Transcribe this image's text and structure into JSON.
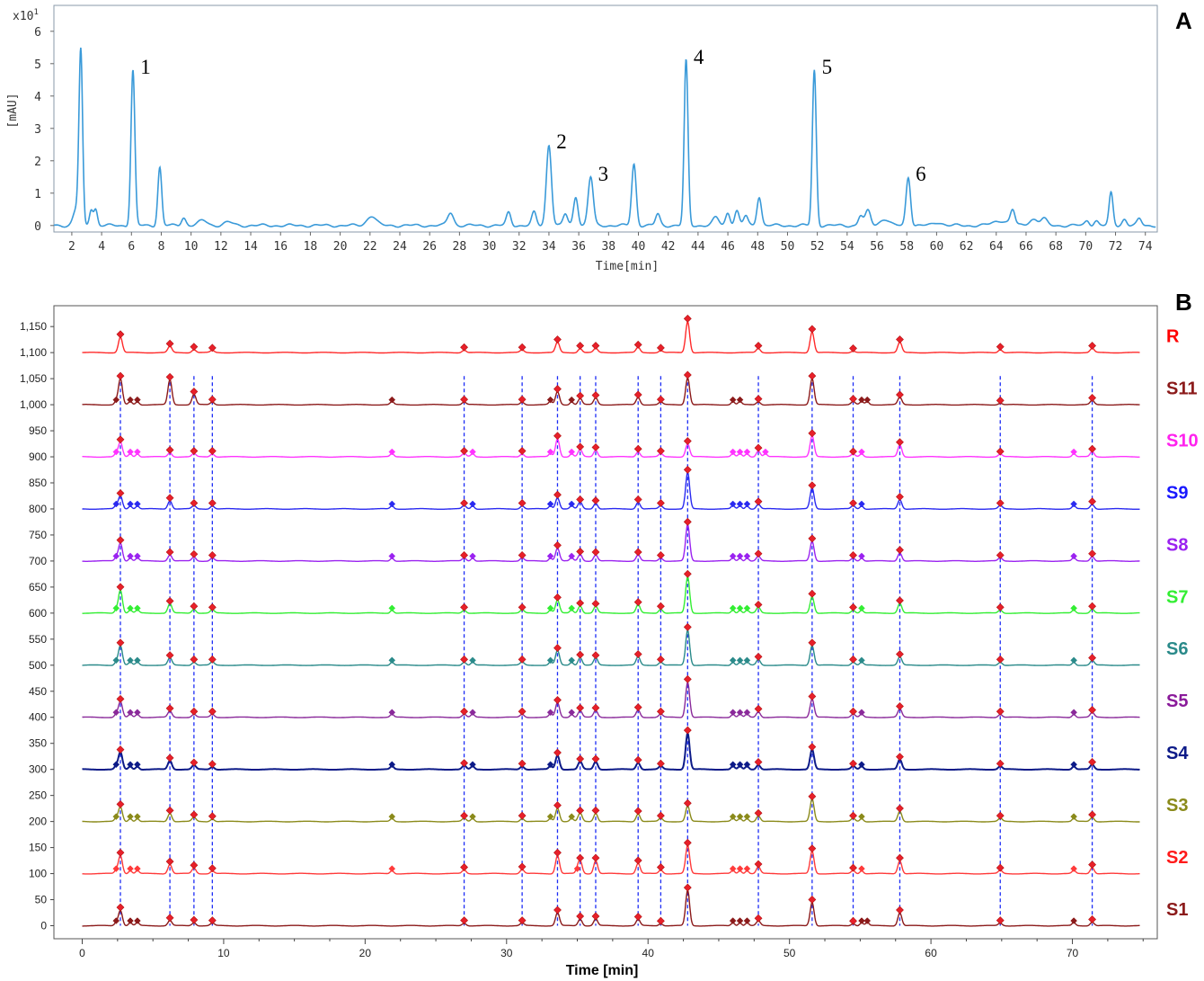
{
  "panel_a": {
    "letter": "A",
    "multiplier": "x10",
    "multiplier_exp": "1",
    "ylabel": "[mAU]",
    "xlabel": "Time[min]"
  },
  "panel_b": {
    "letter": "B",
    "xlabel": "Time [min]"
  },
  "chart_data": [
    {
      "type": "line",
      "panel": "A",
      "xlabel": "Time[min]",
      "ylabel": "[mAU]",
      "y_multiplier": "x10^1",
      "xlim": [
        0.8,
        74.8
      ],
      "ylim": [
        -0.2,
        6.8
      ],
      "x_ticks": [
        2,
        4,
        6,
        8,
        10,
        12,
        14,
        16,
        18,
        20,
        22,
        24,
        26,
        28,
        30,
        32,
        34,
        36,
        38,
        40,
        42,
        44,
        46,
        48,
        50,
        52,
        54,
        56,
        58,
        60,
        62,
        64,
        66,
        68,
        70,
        72,
        74
      ],
      "y_ticks": [
        0,
        1,
        2,
        3,
        4,
        5,
        6
      ],
      "series": [
        {
          "color": "#3a9ad9",
          "peaks": [
            {
              "t": 2.3,
              "h": 0.5,
              "w": 0.2
            },
            {
              "t": 2.6,
              "h": 5.3,
              "w": 0.12
            },
            {
              "t": 3.3,
              "h": 0.5,
              "w": 0.12
            },
            {
              "t": 3.6,
              "h": 0.5,
              "w": 0.12
            },
            {
              "t": 6.1,
              "h": 4.8,
              "w": 0.13
            },
            {
              "t": 7.9,
              "h": 1.8,
              "w": 0.13
            },
            {
              "t": 9.5,
              "h": 0.25,
              "w": 0.15
            },
            {
              "t": 10.8,
              "h": 0.15,
              "w": 0.3
            },
            {
              "t": 12.5,
              "h": 0.1,
              "w": 0.3
            },
            {
              "t": 22.1,
              "h": 0.3,
              "w": 0.3
            },
            {
              "t": 27.4,
              "h": 0.4,
              "w": 0.2
            },
            {
              "t": 31.3,
              "h": 0.4,
              "w": 0.15
            },
            {
              "t": 33.0,
              "h": 0.4,
              "w": 0.15
            },
            {
              "t": 34.0,
              "h": 2.5,
              "w": 0.17
            },
            {
              "t": 35.1,
              "h": 0.35,
              "w": 0.15
            },
            {
              "t": 35.8,
              "h": 0.9,
              "w": 0.15
            },
            {
              "t": 36.8,
              "h": 1.5,
              "w": 0.17
            },
            {
              "t": 39.7,
              "h": 1.9,
              "w": 0.15
            },
            {
              "t": 41.3,
              "h": 0.35,
              "w": 0.15
            },
            {
              "t": 43.2,
              "h": 5.1,
              "w": 0.13
            },
            {
              "t": 45.2,
              "h": 0.25,
              "w": 0.2
            },
            {
              "t": 46.0,
              "h": 0.4,
              "w": 0.15
            },
            {
              "t": 46.6,
              "h": 0.45,
              "w": 0.15
            },
            {
              "t": 47.2,
              "h": 0.3,
              "w": 0.15
            },
            {
              "t": 48.1,
              "h": 0.9,
              "w": 0.15
            },
            {
              "t": 51.8,
              "h": 4.8,
              "w": 0.13
            },
            {
              "t": 54.9,
              "h": 0.3,
              "w": 0.15
            },
            {
              "t": 55.4,
              "h": 0.45,
              "w": 0.18
            },
            {
              "t": 56.5,
              "h": 0.2,
              "w": 0.3
            },
            {
              "t": 58.1,
              "h": 1.5,
              "w": 0.15
            },
            {
              "t": 60.1,
              "h": 0.1,
              "w": 0.3
            },
            {
              "t": 64.3,
              "h": 0.15,
              "w": 0.5
            },
            {
              "t": 65.1,
              "h": 0.45,
              "w": 0.15
            },
            {
              "t": 66.5,
              "h": 0.2,
              "w": 0.3
            },
            {
              "t": 67.2,
              "h": 0.2,
              "w": 0.2
            },
            {
              "t": 70.1,
              "h": 0.15,
              "w": 0.15
            },
            {
              "t": 70.7,
              "h": 0.15,
              "w": 0.15
            },
            {
              "t": 71.7,
              "h": 1.0,
              "w": 0.13
            },
            {
              "t": 72.6,
              "h": 0.2,
              "w": 0.15
            },
            {
              "t": 73.6,
              "h": 0.2,
              "w": 0.15
            }
          ]
        }
      ],
      "annotations": [
        {
          "text": "1",
          "t": 6.1,
          "y": 4.8
        },
        {
          "text": "2",
          "t": 34.0,
          "y": 2.5
        },
        {
          "text": "3",
          "t": 36.8,
          "y": 1.5
        },
        {
          "text": "4",
          "t": 43.2,
          "y": 5.1
        },
        {
          "text": "5",
          "t": 51.8,
          "y": 4.8
        },
        {
          "text": "6",
          "t": 58.1,
          "y": 1.5
        }
      ]
    },
    {
      "type": "line",
      "panel": "B",
      "xlabel": "Time [min]",
      "xlim": [
        -2,
        76
      ],
      "ylim": [
        -25,
        1190
      ],
      "x_ticks": [
        0,
        10,
        20,
        30,
        40,
        50,
        60,
        70
      ],
      "y_ticks": [
        0,
        50,
        100,
        150,
        200,
        250,
        300,
        350,
        400,
        450,
        500,
        550,
        600,
        650,
        700,
        750,
        800,
        850,
        900,
        950,
        1000,
        1050,
        1100,
        1150
      ],
      "x_end": 74.8,
      "common_peaks": [
        2.7,
        6.2,
        7.9,
        9.2,
        27.0,
        31.1,
        33.6,
        35.2,
        36.3,
        39.3,
        40.9,
        42.8,
        47.8,
        51.6,
        54.5,
        57.8,
        64.9,
        71.4
      ],
      "reference_lines": {
        "x": [
          2.7,
          6.2,
          7.9,
          9.2,
          27.0,
          31.1,
          33.6,
          35.2,
          36.3,
          39.3,
          40.9,
          42.8,
          47.8,
          51.6,
          54.5,
          57.8,
          64.9,
          71.4
        ],
        "color": "#1c2cf5"
      },
      "series": [
        {
          "name": "R",
          "offset": 1100,
          "color": "#ff2a2a",
          "label_color": "#ff0000",
          "heights": [
            30,
            12,
            6,
            4,
            5,
            5,
            20,
            8,
            8,
            10,
            4,
            60,
            8,
            40,
            3,
            20,
            6,
            8
          ],
          "extra": []
        },
        {
          "name": "S11",
          "offset": 1000,
          "color": "#8b1a1a",
          "label_color": "#8b1a1a",
          "heights": [
            50,
            48,
            20,
            5,
            5,
            5,
            25,
            12,
            13,
            14,
            5,
            52,
            6,
            50,
            6,
            14,
            3,
            8
          ],
          "extra": [
            2.4,
            3.4,
            3.9,
            21.9,
            33.1,
            34.6,
            46.0,
            46.5,
            55.1,
            55.5
          ]
        },
        {
          "name": "S10",
          "offset": 900,
          "color": "#ff33ff",
          "label_color": "#ff22ee",
          "heights": [
            28,
            8,
            6,
            6,
            6,
            6,
            35,
            14,
            13,
            10,
            6,
            25,
            12,
            40,
            5,
            23,
            5,
            10
          ],
          "extra": [
            2.4,
            3.4,
            3.9,
            21.9,
            27.6,
            33.1,
            34.6,
            46.0,
            46.5,
            47.0,
            48.3,
            55.1,
            70.1
          ]
        },
        {
          "name": "S9",
          "offset": 800,
          "color": "#2a2af0",
          "label_color": "#1818ff",
          "heights": [
            25,
            16,
            6,
            6,
            6,
            6,
            22,
            13,
            11,
            13,
            6,
            70,
            9,
            40,
            6,
            18,
            6,
            9
          ],
          "extra": [
            2.4,
            3.4,
            3.9,
            21.9,
            27.6,
            33.1,
            34.6,
            46.0,
            46.5,
            47.0,
            55.1,
            70.1
          ]
        },
        {
          "name": "S8",
          "offset": 700,
          "color": "#9a22f0",
          "label_color": "#9a22f0",
          "heights": [
            35,
            12,
            8,
            6,
            6,
            6,
            25,
            13,
            12,
            12,
            6,
            70,
            9,
            38,
            6,
            16,
            6,
            9
          ],
          "extra": [
            2.4,
            3.4,
            3.9,
            21.9,
            27.6,
            33.1,
            34.6,
            46.0,
            46.5,
            47.0,
            55.1,
            70.1
          ]
        },
        {
          "name": "S7",
          "offset": 600,
          "color": "#33ee33",
          "label_color": "#33ee33",
          "heights": [
            45,
            18,
            8,
            6,
            6,
            6,
            25,
            14,
            13,
            16,
            8,
            70,
            11,
            32,
            6,
            19,
            6,
            8
          ],
          "extra": [
            2.4,
            3.4,
            3.9,
            21.9,
            33.1,
            34.6,
            46.0,
            46.5,
            47.0,
            55.1,
            70.1
          ]
        },
        {
          "name": "S6",
          "offset": 500,
          "color": "#2a8a8a",
          "label_color": "#2a8a8a",
          "heights": [
            38,
            14,
            6,
            6,
            6,
            6,
            28,
            15,
            14,
            16,
            6,
            68,
            11,
            38,
            6,
            16,
            6,
            9
          ],
          "extra": [
            2.4,
            3.4,
            3.9,
            21.9,
            27.6,
            33.1,
            34.6,
            46.0,
            46.5,
            47.0,
            55.1,
            70.1
          ]
        },
        {
          "name": "S5",
          "offset": 400,
          "color": "#8a2a9a",
          "label_color": "#8a1a9a",
          "heights": [
            30,
            12,
            6,
            6,
            6,
            6,
            28,
            13,
            13,
            14,
            6,
            68,
            11,
            35,
            6,
            16,
            6,
            9
          ],
          "extra": [
            2.4,
            3.4,
            3.9,
            21.9,
            27.6,
            33.1,
            34.6,
            46.0,
            46.5,
            47.0,
            55.1,
            70.1
          ]
        },
        {
          "name": "S4",
          "offset": 300,
          "color": "#0c1a88",
          "label_color": "#0c1a88",
          "heights": [
            33,
            17,
            8,
            5,
            7,
            6,
            27,
            15,
            15,
            13,
            6,
            70,
            9,
            38,
            6,
            19,
            6,
            9
          ],
          "extra": [
            2.4,
            3.4,
            3.9,
            21.9,
            27.6,
            33.1,
            46.0,
            46.5,
            47.0,
            55.1,
            70.1
          ]
        },
        {
          "name": "S3",
          "offset": 200,
          "color": "#8a8a1a",
          "label_color": "#8a8a1a",
          "heights": [
            28,
            16,
            8,
            5,
            6,
            6,
            26,
            16,
            16,
            15,
            6,
            30,
            11,
            43,
            6,
            20,
            6,
            8
          ],
          "extra": [
            2.4,
            3.4,
            3.9,
            21.9,
            27.6,
            33.1,
            34.6,
            46.0,
            46.5,
            47.0,
            55.1,
            70.1
          ]
        },
        {
          "name": "S2",
          "offset": 100,
          "color": "#ff3a3a",
          "label_color": "#ff1a1a",
          "heights": [
            35,
            18,
            11,
            5,
            7,
            8,
            35,
            25,
            25,
            20,
            7,
            54,
            13,
            43,
            6,
            25,
            6,
            12
          ],
          "extra": [
            2.4,
            3.4,
            3.9,
            21.9,
            35.0,
            46.0,
            46.5,
            47.0,
            55.1,
            70.1
          ]
        },
        {
          "name": "S1",
          "offset": 0,
          "color": "#8b1a1a",
          "label_color": "#8b1a1a",
          "heights": [
            30,
            10,
            6,
            5,
            5,
            5,
            25,
            13,
            13,
            12,
            4,
            68,
            9,
            45,
            4,
            25,
            5,
            7
          ],
          "extra": [
            2.4,
            3.4,
            3.9,
            46.0,
            46.5,
            47.0,
            55.1,
            55.5,
            70.1
          ]
        }
      ]
    }
  ]
}
